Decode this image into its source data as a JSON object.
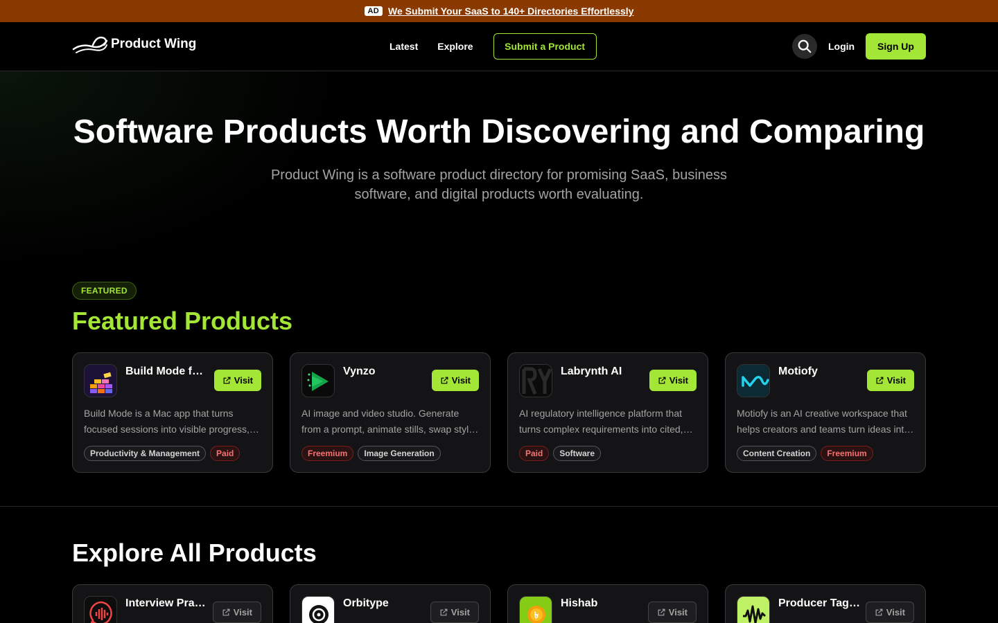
{
  "ad": {
    "badge": "AD",
    "link": "We Submit Your SaaS to 140+ Directories Effortlessly"
  },
  "nav": {
    "logo": "Product Wing",
    "links": [
      "Latest",
      "Explore"
    ],
    "submit": "Submit a Product",
    "login": "Login",
    "signup": "Sign Up"
  },
  "hero": {
    "title": "Software Products Worth Discovering and Comparing",
    "subtitle": "Product Wing is a software product directory for promising SaaS, business software, and digital products worth evaluating."
  },
  "featured": {
    "badge": "FEATURED",
    "title": "Featured Products",
    "visit_label": "Visit",
    "items": [
      {
        "name": "Build Mode for Mac",
        "desc": "Build Mode is a Mac app that turns focused sessions into visible progress, one brick at a time.",
        "tags": [
          {
            "label": "Productivity & Management",
            "kind": "neutral"
          },
          {
            "label": "Paid",
            "kind": "red"
          }
        ]
      },
      {
        "name": "Vynzo",
        "desc": "AI image and video studio. Generate from a prompt, animate stills, swap styles and more.",
        "tags": [
          {
            "label": "Freemium",
            "kind": "red"
          },
          {
            "label": "Image Generation",
            "kind": "neutral"
          }
        ]
      },
      {
        "name": "Labrynth AI",
        "desc": "AI regulatory intelligence platform that turns complex requirements into cited, actionable answers.",
        "tags": [
          {
            "label": "Paid",
            "kind": "red"
          },
          {
            "label": "Software",
            "kind": "neutral"
          }
        ]
      },
      {
        "name": "Motiofy",
        "desc": "Motiofy is an AI creative workspace that helps creators and teams turn ideas into content.",
        "tags": [
          {
            "label": "Content Creation",
            "kind": "neutral"
          },
          {
            "label": "Freemium",
            "kind": "red"
          }
        ]
      }
    ]
  },
  "explore": {
    "title": "Explore All Products",
    "visit_label": "Visit",
    "items": [
      {
        "name": "Interview Practice AI"
      },
      {
        "name": "Orbitype"
      },
      {
        "name": "Hishab"
      },
      {
        "name": "Producer Tag Maker"
      }
    ]
  },
  "colors": {
    "accent": "#a3e635",
    "ad_bg": "#8a3a00",
    "tag_red": "#f87171"
  }
}
